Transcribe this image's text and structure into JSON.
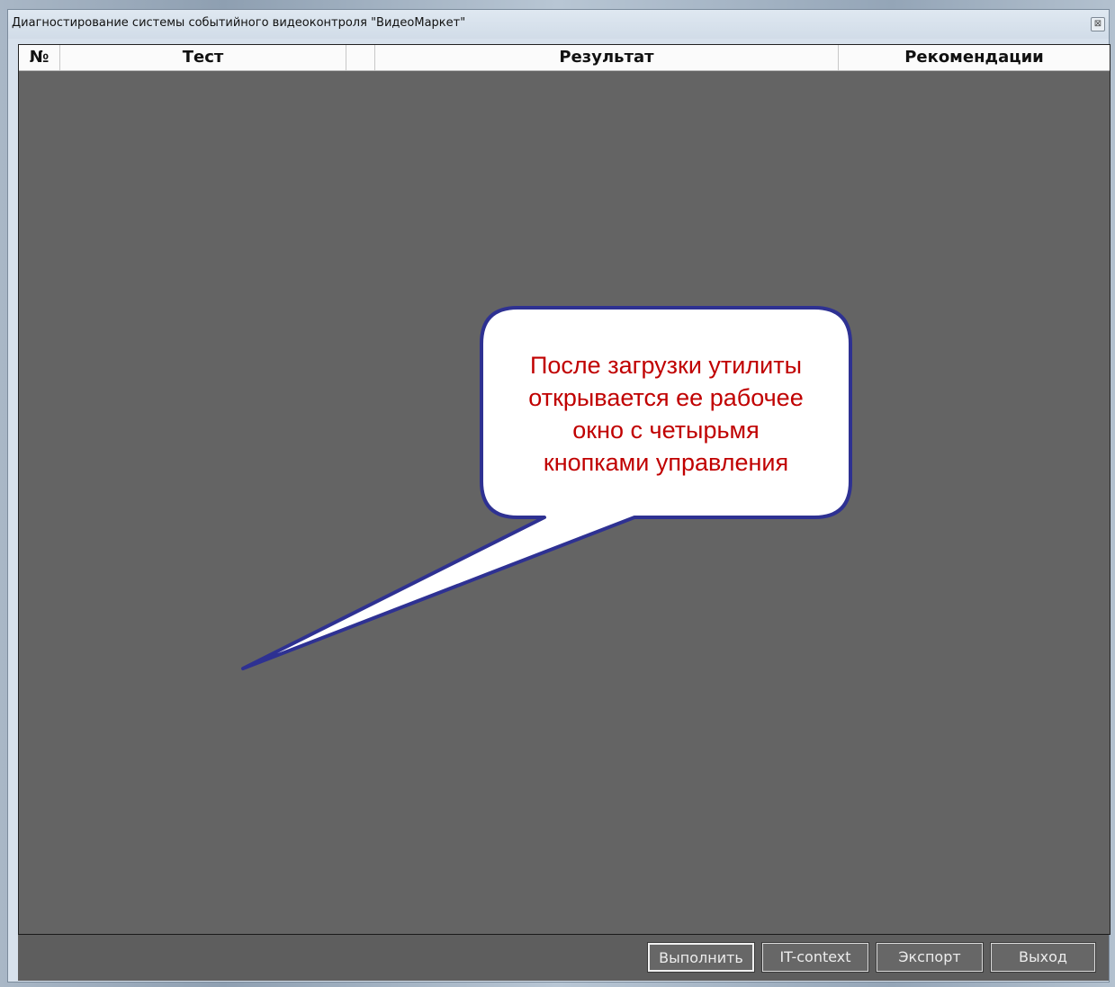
{
  "window": {
    "title": "Диагностирование системы событийного видеоконтроля \"ВидеоМаркет\"",
    "close_glyph": "⊠"
  },
  "table": {
    "columns": [
      "№",
      "Тест",
      "",
      "Результат",
      "Рекомендации"
    ],
    "rows": []
  },
  "callout": {
    "lines": [
      "После загрузки утилиты",
      "открывается ее рабочее",
      "окно с четырьмя",
      "кнопками управления"
    ],
    "text_color": "#c00000",
    "border_color": "#2e3192"
  },
  "footer": {
    "buttons": [
      {
        "label": "Выполнить"
      },
      {
        "label": "IT-context"
      },
      {
        "label": "Экспорт"
      },
      {
        "label": "Выход"
      }
    ]
  }
}
